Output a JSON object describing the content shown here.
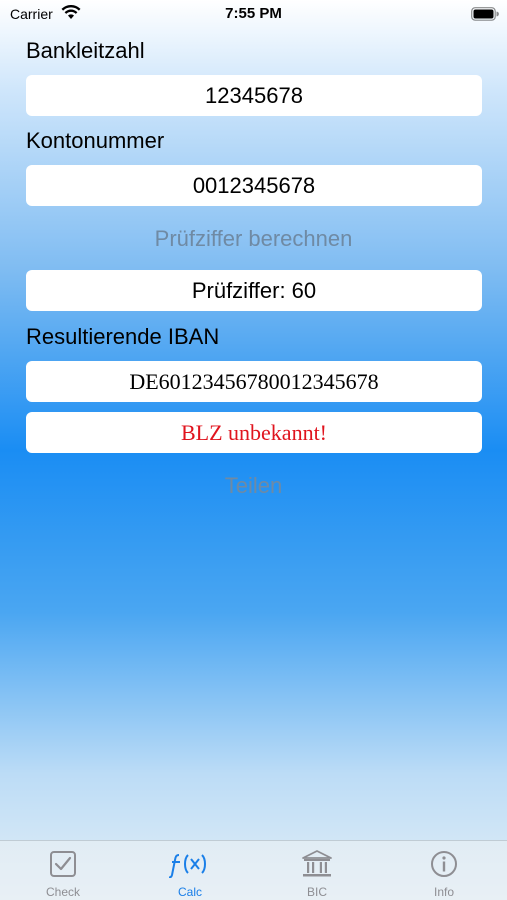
{
  "status_bar": {
    "carrier": "Carrier",
    "time": "7:55 PM",
    "wifi_icon": "wifi-icon",
    "battery_icon": "battery-icon"
  },
  "form": {
    "blz_label": "Bankleitzahl",
    "blz_value": "12345678",
    "konto_label": "Kontonummer",
    "konto_value": "0012345678",
    "calc_button": "Prüfziffer berechnen",
    "checksum_text": "Prüfziffer: 60",
    "iban_label": "Resultierende IBAN",
    "iban_value": "DE60123456780012345678",
    "status_text": "BLZ unbekannt!",
    "share_button": "Teilen"
  },
  "colors": {
    "accent": "#1a7fe8",
    "error": "#e0141e",
    "inactive": "#8e8e93"
  },
  "tabs": [
    {
      "label": "Check",
      "icon": "checkbox-icon",
      "active": false
    },
    {
      "label": "Calc",
      "icon": "function-icon",
      "active": true
    },
    {
      "label": "BIC",
      "icon": "bank-icon",
      "active": false
    },
    {
      "label": "Info",
      "icon": "info-icon",
      "active": false
    }
  ]
}
